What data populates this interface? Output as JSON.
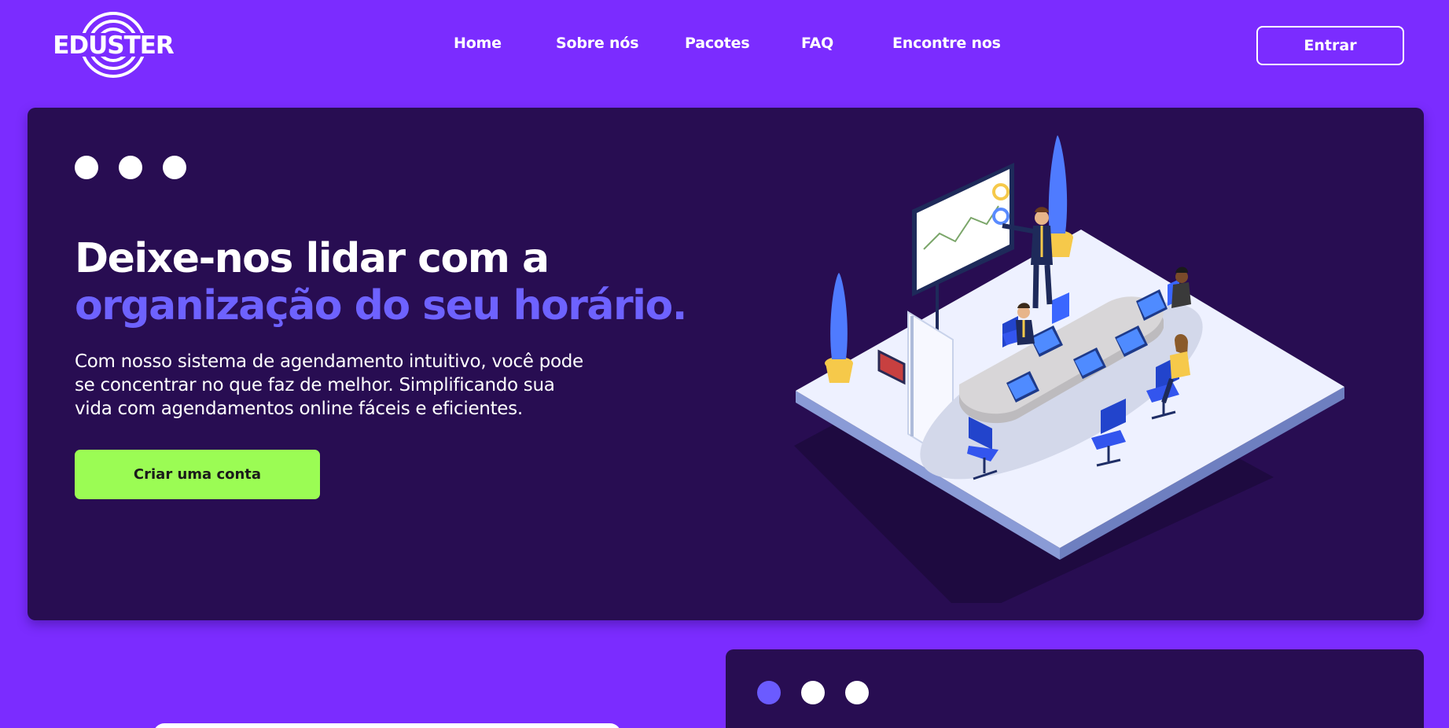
{
  "brand": {
    "logo_text": "EDUSTER"
  },
  "nav": {
    "items": [
      {
        "label": "Home"
      },
      {
        "label": "Sobre nós"
      },
      {
        "label": "Pacotes"
      },
      {
        "label": "FAQ"
      },
      {
        "label": "Encontre nos"
      }
    ]
  },
  "header": {
    "login_label": "Entrar"
  },
  "hero": {
    "headline_line1": "Deixe-nos lidar com a",
    "headline_line2": "organização do seu horário.",
    "description": "Com nosso sistema de agendamento intuitivo, você pode se concentrar no que faz de melhor. Simplificando sua vida com agendamentos online fáceis e eficientes.",
    "cta_label": "Criar uma conta"
  },
  "colors": {
    "background": "#7B2CFF",
    "card": "#280D52",
    "accent": "#6E62FF",
    "cta": "#9BFC54"
  },
  "icons": [
    "eduster-logo",
    "window-dots",
    "meeting-room-illustration"
  ]
}
